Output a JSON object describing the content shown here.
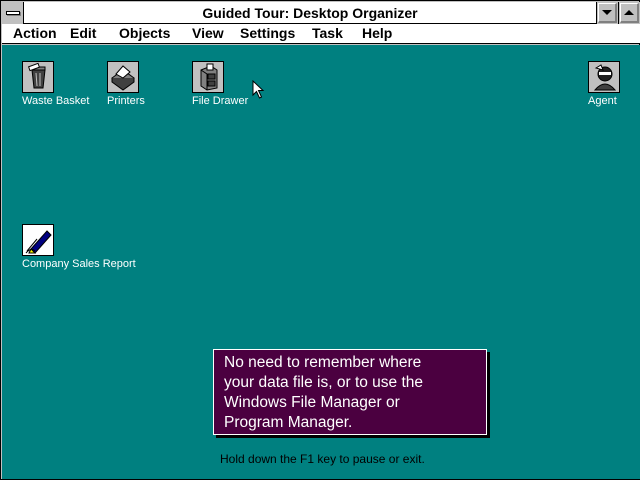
{
  "window": {
    "title": "Guided Tour: Desktop Organizer"
  },
  "menu": [
    "Action",
    "Edit",
    "Objects",
    "View",
    "Settings",
    "Task",
    "Help"
  ],
  "desktop_icons": [
    {
      "label": "Waste Basket",
      "icon": "waste-basket-icon"
    },
    {
      "label": "Printers",
      "icon": "printer-icon"
    },
    {
      "label": "File Drawer",
      "icon": "file-drawer-icon"
    },
    {
      "label": "Agent",
      "icon": "agent-icon"
    },
    {
      "label": "Company Sales Report",
      "icon": "document-pen-icon"
    }
  ],
  "tour": {
    "lines": [
      "No need to remember where",
      "your data file is, or to use the",
      "Windows File Manager or",
      "Program Manager."
    ],
    "hint": "Hold down the F1 key to pause or exit."
  },
  "colors": {
    "desktop": "#008080",
    "tour_box": "#4b0040"
  }
}
